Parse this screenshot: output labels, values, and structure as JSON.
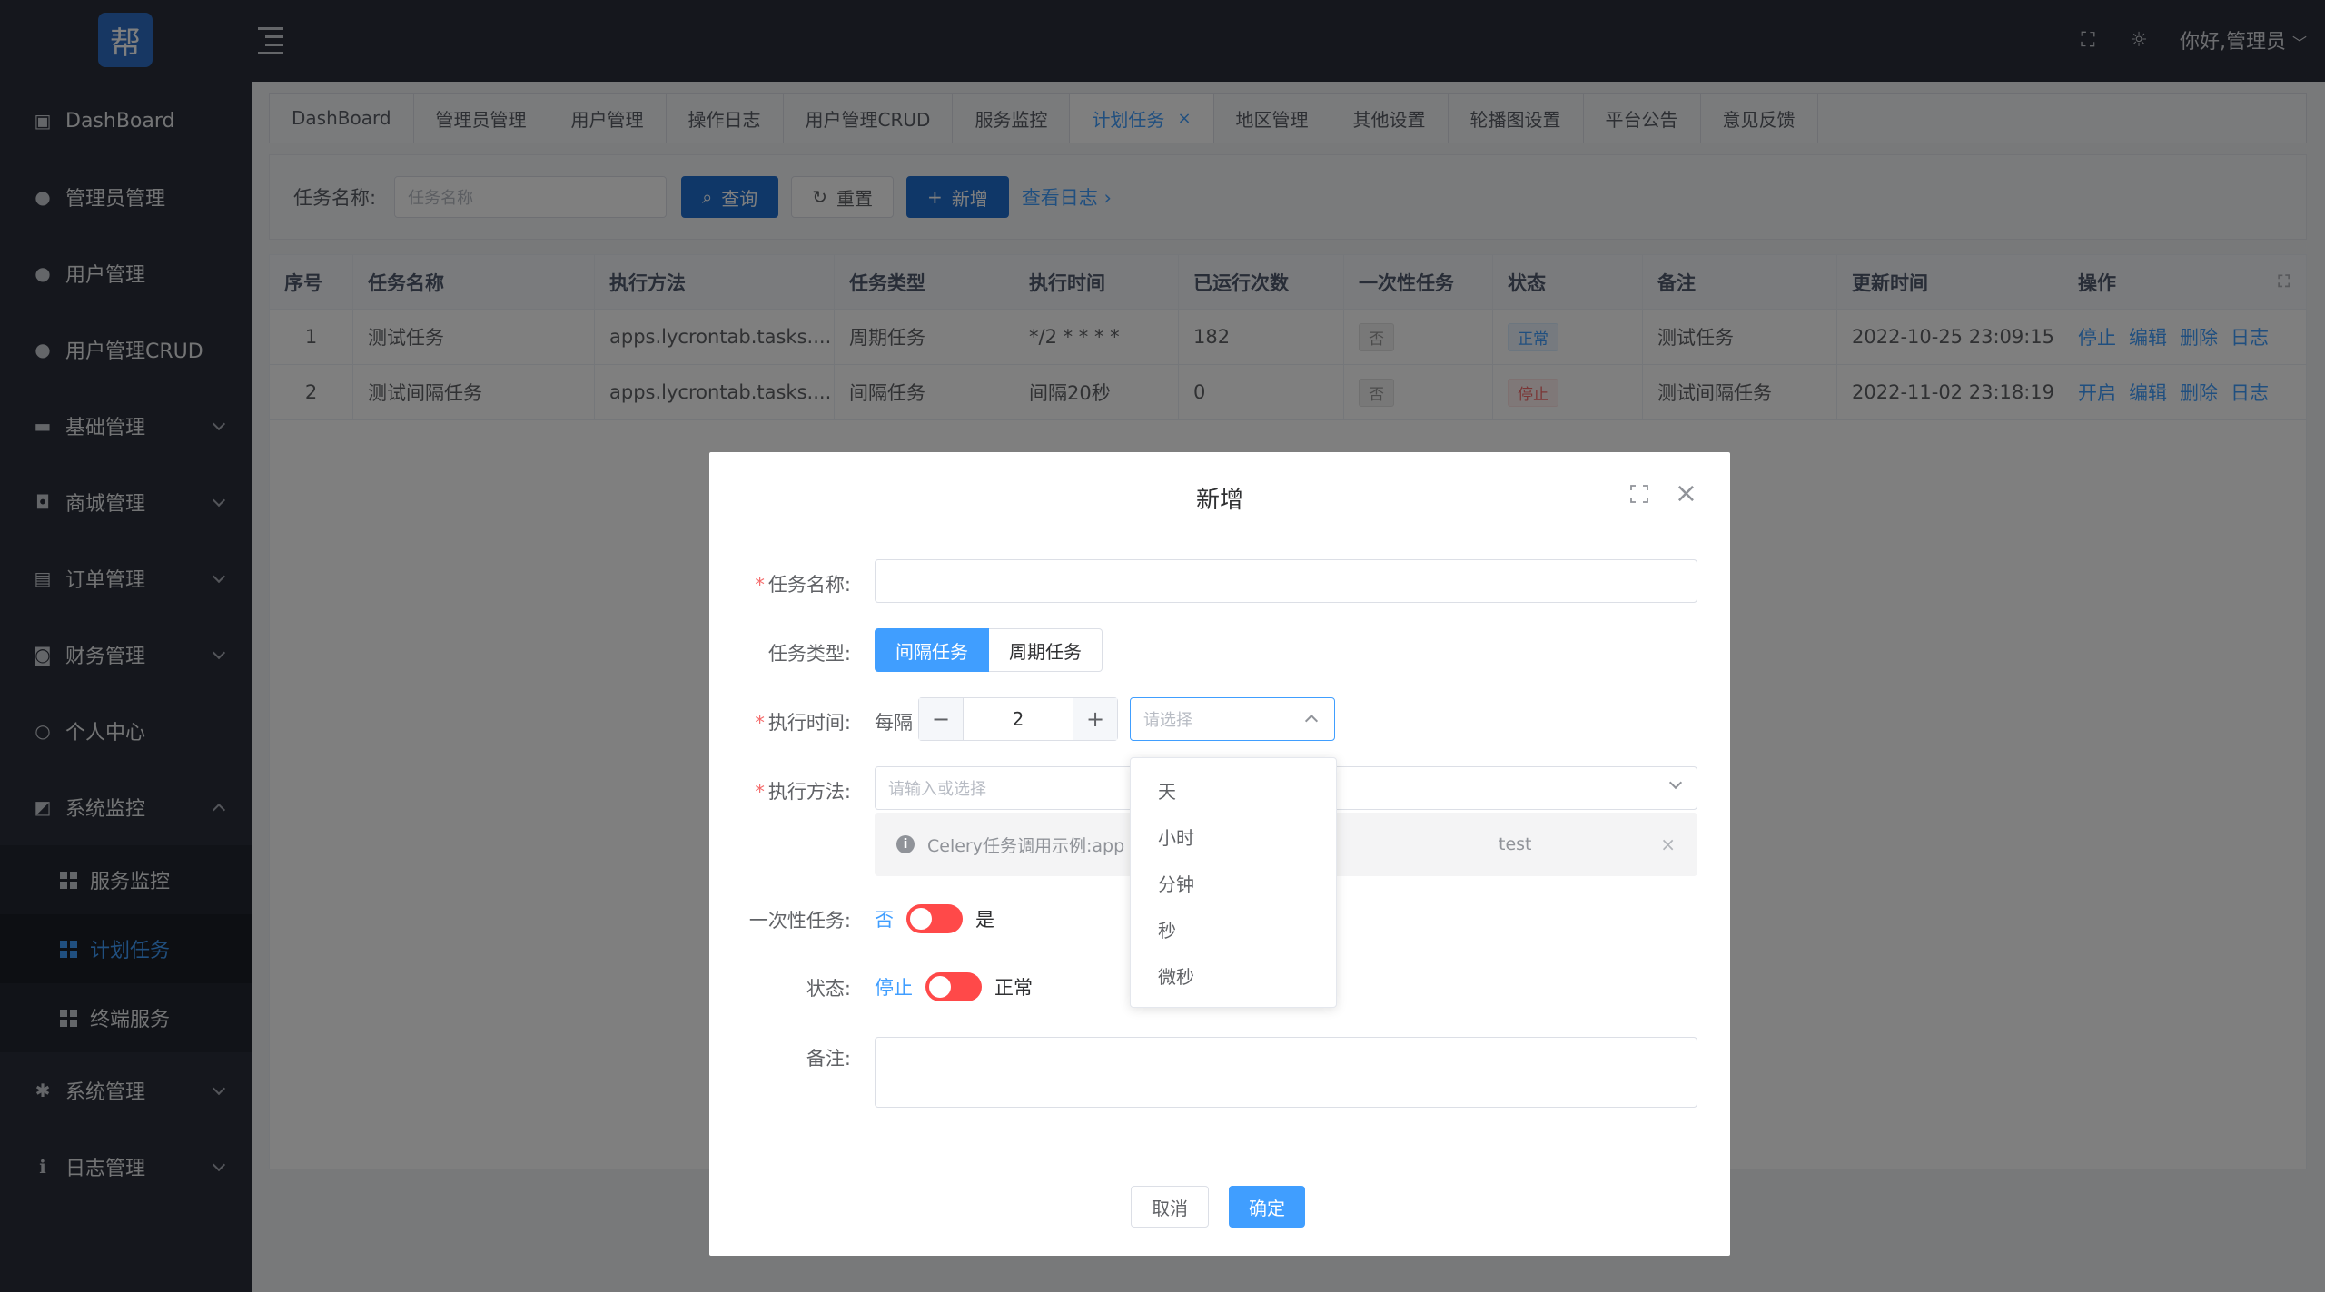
{
  "app": {
    "logo_char": "帮"
  },
  "sidebar": {
    "items": [
      {
        "label": "DashBoard",
        "icon": "dashboard-icon"
      },
      {
        "label": "管理员管理",
        "icon": "user-icon"
      },
      {
        "label": "用户管理",
        "icon": "user-icon"
      },
      {
        "label": "用户管理CRUD",
        "icon": "user-icon"
      },
      {
        "label": "基础管理",
        "icon": "monitor-icon"
      },
      {
        "label": "商城管理",
        "icon": "shop-icon"
      },
      {
        "label": "订单管理",
        "icon": "order-icon"
      },
      {
        "label": "财务管理",
        "icon": "finance-icon"
      },
      {
        "label": "个人中心",
        "icon": "person-icon"
      },
      {
        "label": "系统监控",
        "icon": "chart-icon"
      }
    ],
    "monitor_children": [
      {
        "label": "服务监控"
      },
      {
        "label": "计划任务"
      },
      {
        "label": "终端服务"
      }
    ],
    "bottom_items": [
      {
        "label": "系统管理",
        "icon": "gear-icon"
      },
      {
        "label": "日志管理",
        "icon": "info-icon"
      }
    ]
  },
  "header": {
    "greeting": "你好,管理员"
  },
  "tabs": [
    {
      "label": "DashBoard"
    },
    {
      "label": "管理员管理"
    },
    {
      "label": "用户管理"
    },
    {
      "label": "操作日志"
    },
    {
      "label": "用户管理CRUD"
    },
    {
      "label": "服务监控"
    },
    {
      "label": "计划任务",
      "close": "×"
    },
    {
      "label": "地区管理"
    },
    {
      "label": "其他设置"
    },
    {
      "label": "轮播图设置"
    },
    {
      "label": "平台公告"
    },
    {
      "label": "意见反馈"
    }
  ],
  "search": {
    "label": "任务名称:",
    "placeholder": "任务名称",
    "query_btn": "查询",
    "reset_btn": "重置",
    "add_btn": "新增",
    "log_link": "查看日志"
  },
  "table": {
    "headers": [
      "序号",
      "任务名称",
      "执行方法",
      "任务类型",
      "执行时间",
      "已运行次数",
      "一次性任务",
      "状态",
      "备注",
      "更新时间",
      "操作"
    ],
    "rows": [
      {
        "no": "1",
        "name": "测试任务",
        "method": "apps.lycrontab.tasks....",
        "type": "周期任务",
        "time": "*/2 * * * *",
        "count": "182",
        "once": "否",
        "status": "正常",
        "remark": "测试任务",
        "updated": "2022-10-25 23:09:15",
        "ops": [
          "停止",
          "编辑",
          "删除",
          "日志"
        ]
      },
      {
        "no": "2",
        "name": "测试间隔任务",
        "method": "apps.lycrontab.tasks....",
        "type": "间隔任务",
        "time": "间隔20秒",
        "count": "0",
        "once": "否",
        "status": "停止",
        "remark": "测试间隔任务",
        "updated": "2022-11-02 23:18:19",
        "ops": [
          "开启",
          "编辑",
          "删除",
          "日志"
        ]
      }
    ]
  },
  "dialog": {
    "title": "新增",
    "task_name_label": "任务名称:",
    "task_type_label": "任务类型:",
    "task_type_options": [
      "间隔任务",
      "周期任务"
    ],
    "exec_time_label": "执行时间:",
    "every_text": "每隔",
    "interval_value": "2",
    "unit_placeholder": "请选择",
    "method_label": "执行方法:",
    "method_placeholder": "请输入或选择",
    "alert_text": "Celery任务调用示例:app",
    "alert_tail": "test",
    "once_label": "一次性任务:",
    "once_off": "否",
    "once_on": "是",
    "status_label": "状态:",
    "status_off": "停止",
    "status_on": "正常",
    "remark_label": "备注:",
    "cancel_btn": "取消",
    "confirm_btn": "确定"
  },
  "unit_dropdown": [
    "天",
    "小时",
    "分钟",
    "秒",
    "微秒"
  ],
  "colors": {
    "primary": "#409eff",
    "sidebar_bg": "#2b2f3a",
    "danger": "#ff4949"
  }
}
